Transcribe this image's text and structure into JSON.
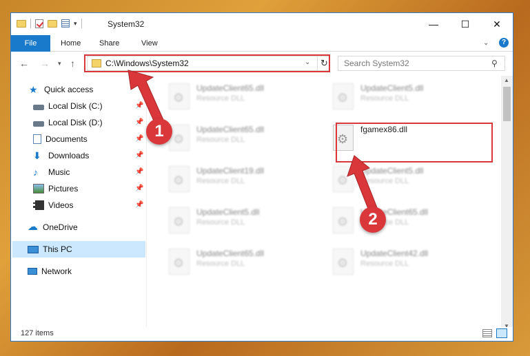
{
  "window": {
    "title": "System32"
  },
  "ribbon": {
    "tabs": [
      "File",
      "Home",
      "Share",
      "View"
    ]
  },
  "nav": {
    "address": "C:\\Windows\\System32",
    "search_placeholder": "Search System32"
  },
  "sidebar": {
    "items": [
      {
        "label": "Quick access",
        "icon": "star-icon",
        "pinned": false
      },
      {
        "label": "Local Disk (C:)",
        "icon": "drive-icon",
        "pinned": true
      },
      {
        "label": "Local Disk (D:)",
        "icon": "drive-icon",
        "pinned": true
      },
      {
        "label": "Documents",
        "icon": "documents-icon",
        "pinned": true
      },
      {
        "label": "Downloads",
        "icon": "download-icon",
        "pinned": true
      },
      {
        "label": "Music",
        "icon": "music-icon",
        "pinned": true
      },
      {
        "label": "Pictures",
        "icon": "pictures-icon",
        "pinned": true
      },
      {
        "label": "Videos",
        "icon": "videos-icon",
        "pinned": true
      },
      {
        "label": "OneDrive",
        "icon": "cloud-icon",
        "pinned": false
      },
      {
        "label": "This PC",
        "icon": "computer-icon",
        "pinned": false,
        "selected": true
      },
      {
        "label": "Network",
        "icon": "network-icon",
        "pinned": false
      }
    ]
  },
  "files": [
    {
      "name": "UpdateClient65.dll",
      "type": "Resource DLL"
    },
    {
      "name": "UpdateClient5.dll",
      "type": "Resource DLL"
    },
    {
      "name": "UpdateClient65.dll",
      "type": "Resource DLL"
    },
    {
      "name": "fgamex86.dll",
      "type": "",
      "highlighted": true
    },
    {
      "name": "UpdateClient19.dll",
      "type": "Resource DLL"
    },
    {
      "name": "UpdateClient5.dll",
      "type": "Resource DLL"
    },
    {
      "name": "UpdateClient5.dll",
      "type": "Resource DLL"
    },
    {
      "name": "UpdateClient65.dll",
      "type": "Resource DLL"
    },
    {
      "name": "UpdateClient65.dll",
      "type": "Resource DLL"
    },
    {
      "name": "UpdateClient42.dll",
      "type": "Resource DLL"
    }
  ],
  "status": {
    "count": "127 items"
  },
  "annotations": {
    "step1": "1",
    "step2": "2"
  },
  "colors": {
    "accent": "#1979ca",
    "highlight": "#d9373a",
    "selection": "#cce8ff"
  }
}
